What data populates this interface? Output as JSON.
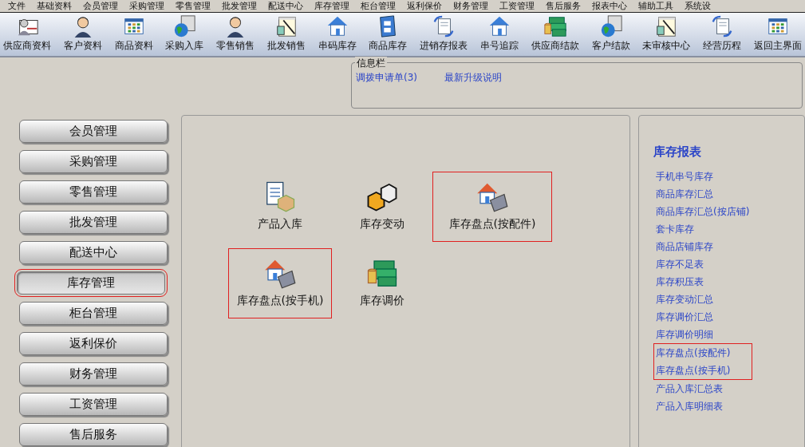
{
  "menu_bar": [
    "文件",
    "基础资料",
    "会员管理",
    "采购管理",
    "零售管理",
    "批发管理",
    "配送中心",
    "库存管理",
    "柜台管理",
    "返利保价",
    "财务管理",
    "工资管理",
    "售后服务",
    "报表中心",
    "辅助工具",
    "系统设"
  ],
  "toolbar": [
    {
      "label": "供应商资料",
      "kind": "card"
    },
    {
      "label": "客户资料",
      "kind": "person"
    },
    {
      "label": "商品资料",
      "kind": "grid"
    },
    {
      "label": "采购入库",
      "kind": "globe"
    },
    {
      "label": "零售销售",
      "kind": "person"
    },
    {
      "label": "批发销售",
      "kind": "notepad"
    },
    {
      "label": "串码库存",
      "kind": "house"
    },
    {
      "label": "商品库存",
      "kind": "cabinet"
    },
    {
      "label": "进销存报表",
      "kind": "doc"
    },
    {
      "label": "串号追踪",
      "kind": "house"
    },
    {
      "label": "供应商结款",
      "kind": "money"
    },
    {
      "label": "客户结款",
      "kind": "globe"
    },
    {
      "label": "未审核中心",
      "kind": "notepad"
    },
    {
      "label": "经营历程",
      "kind": "doc"
    },
    {
      "label": "返回主界面",
      "kind": "grid"
    }
  ],
  "info_panel": {
    "title": "信息栏",
    "links": [
      "调拨申请单(3)",
      "最新升级说明"
    ]
  },
  "sidebar": [
    {
      "label": "会员管理",
      "selected": false,
      "highlighted": false
    },
    {
      "label": "采购管理",
      "selected": false,
      "highlighted": false
    },
    {
      "label": "零售管理",
      "selected": false,
      "highlighted": false
    },
    {
      "label": "批发管理",
      "selected": false,
      "highlighted": false
    },
    {
      "label": "配送中心",
      "selected": false,
      "highlighted": false
    },
    {
      "label": "库存管理",
      "selected": true,
      "highlighted": true
    },
    {
      "label": "柜台管理",
      "selected": false,
      "highlighted": false
    },
    {
      "label": "返利保价",
      "selected": false,
      "highlighted": false
    },
    {
      "label": "财务管理",
      "selected": false,
      "highlighted": false
    },
    {
      "label": "工资管理",
      "selected": false,
      "highlighted": false
    },
    {
      "label": "售后服务",
      "selected": false,
      "highlighted": false
    }
  ],
  "modules": [
    {
      "label": "产品入库",
      "kind": "doc-box",
      "highlighted": false
    },
    {
      "label": "库存变动",
      "kind": "boxes",
      "highlighted": false
    },
    {
      "label": "库存盘点(按配件)",
      "kind": "house-keypad",
      "highlighted": true
    },
    {
      "label": "库存盘点(按手机)",
      "kind": "house-keypad",
      "highlighted": true
    },
    {
      "label": "库存调价",
      "kind": "money",
      "highlighted": false
    }
  ],
  "reports": {
    "title": "库存报表",
    "links": [
      {
        "label": "手机串号库存",
        "highlighted": false
      },
      {
        "label": "商品库存汇总",
        "highlighted": false
      },
      {
        "label": "商品库存汇总(按店铺)",
        "highlighted": false
      },
      {
        "label": "套卡库存",
        "highlighted": false
      },
      {
        "label": "商品店铺库存",
        "highlighted": false
      },
      {
        "label": "库存不足表",
        "highlighted": false
      },
      {
        "label": "库存积压表",
        "highlighted": false
      },
      {
        "label": "库存变动汇总",
        "highlighted": false
      },
      {
        "label": "库存调价汇总",
        "highlighted": false
      },
      {
        "label": "库存调价明细",
        "highlighted": false
      },
      {
        "label": "库存盘点(按配件)",
        "highlighted": true
      },
      {
        "label": "库存盘点(按手机)",
        "highlighted": true
      },
      {
        "label": "产品入库汇总表",
        "highlighted": false
      },
      {
        "label": "产品入库明细表",
        "highlighted": false
      }
    ]
  }
}
